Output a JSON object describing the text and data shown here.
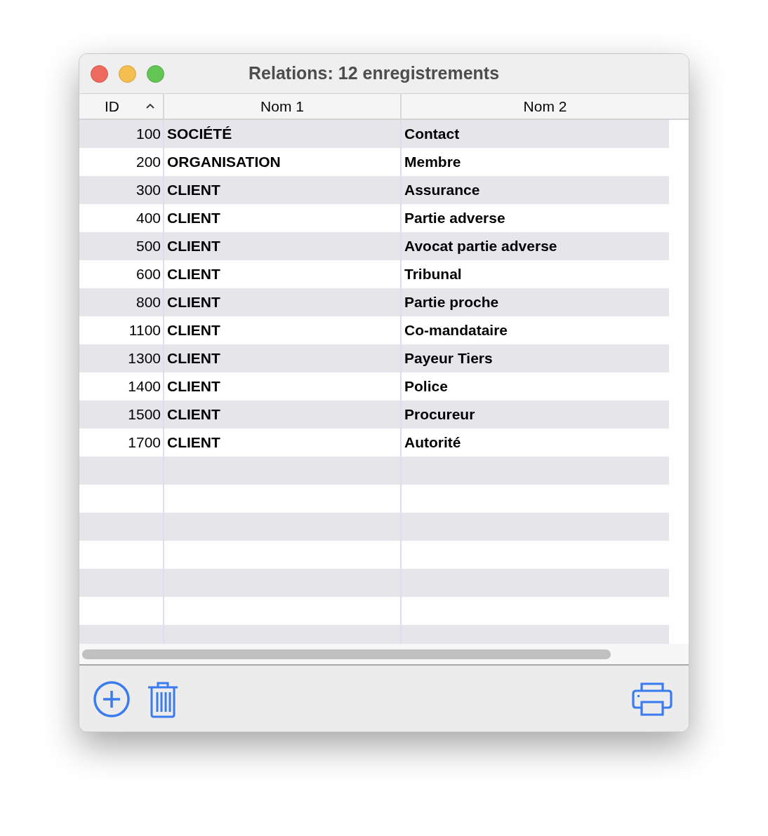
{
  "window": {
    "title": "Relations: 12 enregistrements"
  },
  "table": {
    "columns": [
      {
        "label": "ID",
        "sorted": true
      },
      {
        "label": "Nom 1",
        "sorted": false
      },
      {
        "label": "Nom 2",
        "sorted": false
      }
    ],
    "rows": [
      {
        "id": "100",
        "nom_1": "SOCIÉTÉ",
        "nom_2": "Contact"
      },
      {
        "id": "200",
        "nom_1": "ORGANISATION",
        "nom_2": "Membre"
      },
      {
        "id": "300",
        "nom_1": "CLIENT",
        "nom_2": "Assurance"
      },
      {
        "id": "400",
        "nom_1": "CLIENT",
        "nom_2": "Partie adverse"
      },
      {
        "id": "500",
        "nom_1": "CLIENT",
        "nom_2": "Avocat partie adverse"
      },
      {
        "id": "600",
        "nom_1": "CLIENT",
        "nom_2": "Tribunal"
      },
      {
        "id": "800",
        "nom_1": "CLIENT",
        "nom_2": "Partie proche"
      },
      {
        "id": "1100",
        "nom_1": "CLIENT",
        "nom_2": "Co-mandataire"
      },
      {
        "id": "1300",
        "nom_1": "CLIENT",
        "nom_2": "Payeur Tiers"
      },
      {
        "id": "1400",
        "nom_1": "CLIENT",
        "nom_2": "Police"
      },
      {
        "id": "1500",
        "nom_1": "CLIENT",
        "nom_2": "Procureur"
      },
      {
        "id": "1700",
        "nom_1": "CLIENT",
        "nom_2": "Autorité"
      }
    ]
  }
}
